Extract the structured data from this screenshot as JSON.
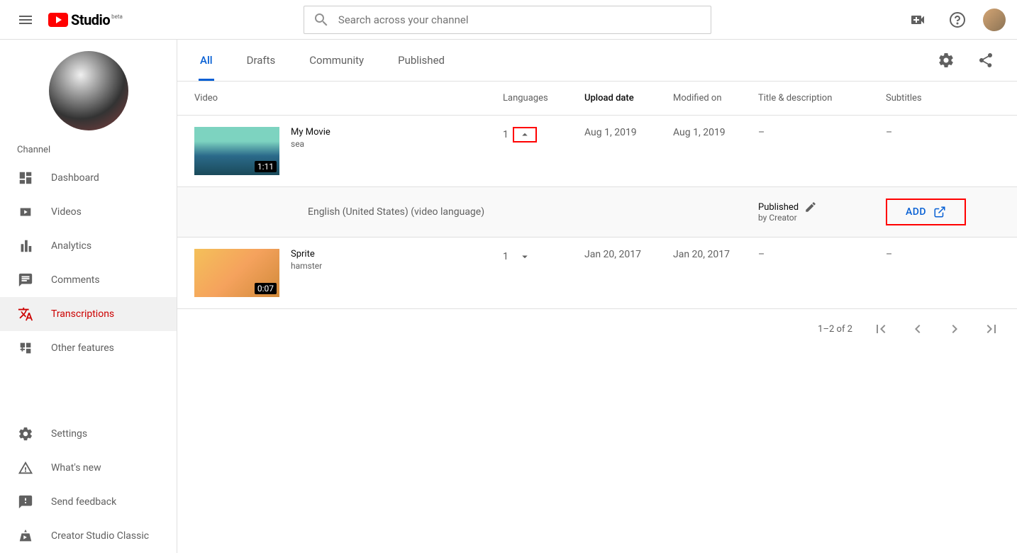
{
  "header": {
    "logo_text": "Studio",
    "logo_badge": "beta",
    "search_placeholder": "Search across your channel"
  },
  "sidebar": {
    "channel_label": "Channel",
    "nav": [
      {
        "label": "Dashboard"
      },
      {
        "label": "Videos"
      },
      {
        "label": "Analytics"
      },
      {
        "label": "Comments"
      },
      {
        "label": "Transcriptions"
      },
      {
        "label": "Other features"
      }
    ],
    "bottom": [
      {
        "label": "Settings"
      },
      {
        "label": "What's new"
      },
      {
        "label": "Send feedback"
      },
      {
        "label": "Creator Studio Classic"
      }
    ]
  },
  "tabs": [
    "All",
    "Drafts",
    "Community",
    "Published"
  ],
  "columns": {
    "video": "Video",
    "languages": "Languages",
    "upload": "Upload date",
    "modified": "Modified on",
    "td": "Title & description",
    "sub": "Subtitles"
  },
  "rows": [
    {
      "title": "My Movie",
      "subtitle": "sea",
      "duration": "1:11",
      "lang_count": "1",
      "upload": "Aug 1, 2019",
      "modified": "Aug 1, 2019",
      "td": "–",
      "sub": "–"
    },
    {
      "title": "Sprite",
      "subtitle": "hamster",
      "duration": "0:07",
      "lang_count": "1",
      "upload": "Jan 20, 2017",
      "modified": "Jan 20, 2017",
      "td": "–",
      "sub": "–"
    }
  ],
  "expanded": {
    "language": "English (United States) (video language)",
    "status": "Published",
    "by": "by Creator",
    "add_label": "ADD"
  },
  "pagination": {
    "range": "1–2 of 2"
  }
}
